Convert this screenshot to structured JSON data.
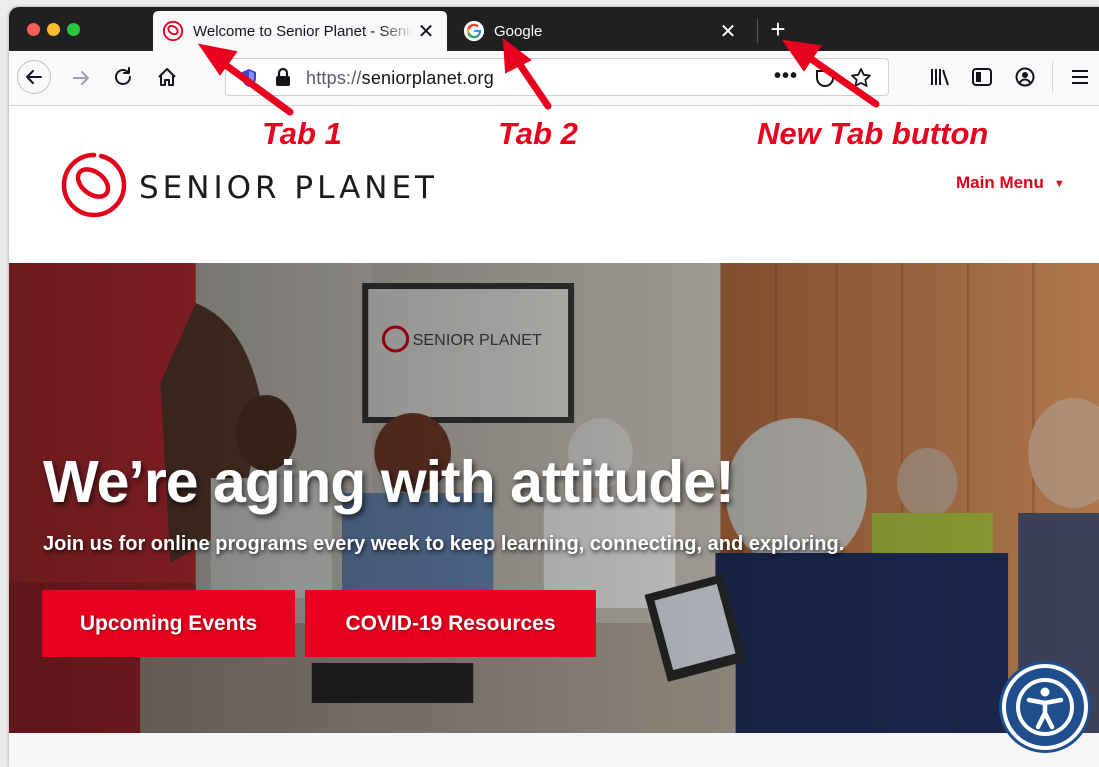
{
  "browser": {
    "tabs": [
      {
        "title": "Welcome to Senior Planet - Senior Planet",
        "favicon": "senior-planet-logo",
        "active": true
      },
      {
        "title": "Google",
        "favicon": "google-g-logo",
        "active": false
      }
    ],
    "new_tab_icon": "plus-icon",
    "close_icon": "close-x-icon",
    "url": {
      "scheme": "https://",
      "host": "seniorplanet.org"
    },
    "toolbar_icons": [
      "back-arrow-icon",
      "forward-arrow-icon",
      "reload-icon",
      "home-icon",
      "tracking-shield-icon",
      "lock-icon",
      "page-actions-dots-icon",
      "pocket-icon",
      "bookmark-star-icon",
      "library-icon",
      "sidebar-icon",
      "account-icon",
      "hamburger-menu-icon"
    ]
  },
  "annotations": {
    "tab1": "Tab 1",
    "tab2": "Tab 2",
    "new_tab": "New Tab button"
  },
  "site": {
    "brand": "SENIOR PLANET",
    "main_menu": "Main Menu",
    "hero": {
      "headline": "We’re aging with attitude!",
      "subline": "Join us for online programs every week to keep learning, connecting, and exploring.",
      "buttons": [
        "Upcoming Events",
        "COVID-19 Resources"
      ]
    },
    "accessibility_icon": "accessibility-person-icon"
  },
  "colors": {
    "brand_red": "#e8001e",
    "tab_strip": "#202023",
    "toolbar": "#f9f9fb",
    "a11y_blue": "#1e4e8c"
  }
}
